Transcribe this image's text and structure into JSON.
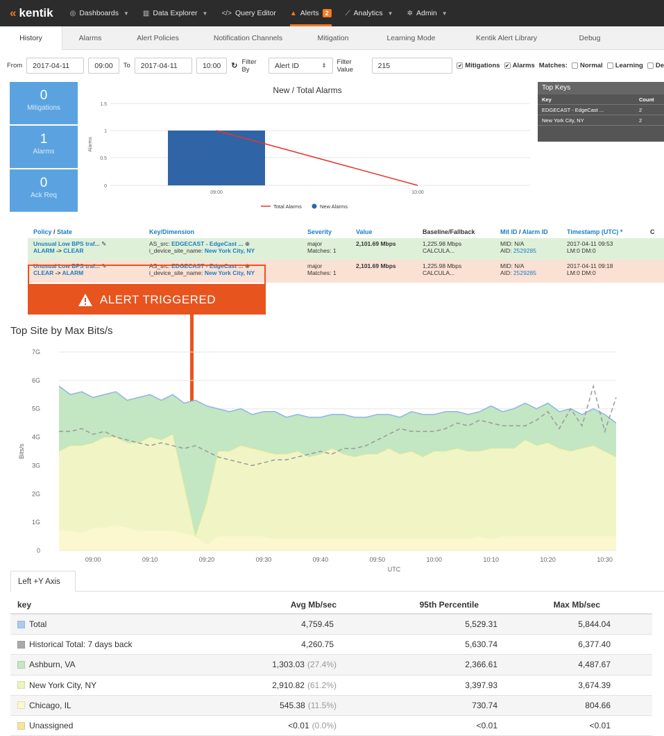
{
  "nav": {
    "logo": "kentik",
    "items": [
      {
        "label": "Dashboards",
        "icon": "gauge-icon",
        "caret": true
      },
      {
        "label": "Data Explorer",
        "icon": "bar-chart-icon",
        "caret": true
      },
      {
        "label": "Query Editor",
        "icon": "code-icon",
        "caret": false
      },
      {
        "label": "Alerts",
        "icon": "bell-icon",
        "caret": false,
        "badge": "2"
      },
      {
        "label": "Analytics",
        "icon": "line-chart-icon",
        "caret": true
      },
      {
        "label": "Admin",
        "icon": "gear-icon",
        "caret": true
      }
    ]
  },
  "subtabs": [
    "History",
    "Alarms",
    "Alert Policies",
    "Notification Channels",
    "Mitigation",
    "Learning Mode",
    "Kentik Alert Library",
    "Debug"
  ],
  "filter": {
    "from_label": "From",
    "from_date": "2017-04-11",
    "from_time": "09:00",
    "to_label": "To",
    "to_date": "2017-04-11",
    "to_time": "10:00",
    "filter_by_label": "Filter By",
    "filter_by_value": "Alert ID",
    "filter_value_label": "Filter Value",
    "filter_value": "215",
    "mitigations": "Mitigations",
    "alarms": "Alarms",
    "matches_label": "Matches:",
    "normal": "Normal",
    "learning": "Learning",
    "d_label": "De"
  },
  "stats": [
    {
      "value": "0",
      "label": "Mitigations"
    },
    {
      "value": "1",
      "label": "Alarms"
    },
    {
      "value": "0",
      "label": "Ack Req"
    }
  ],
  "alarm_chart": {
    "title": "New / Total Alarms",
    "ylabel": "Alarms",
    "yticks": [
      "1.5",
      "1",
      "0.5",
      "0"
    ],
    "xticks": [
      "09:00",
      "10:00"
    ],
    "legend": [
      "Total Alarms",
      "New Alarms"
    ],
    "colors": {
      "total": "#e3342f",
      "new": "#2f64a7"
    }
  },
  "top_keys": {
    "title": "Top Keys",
    "headers": [
      "Key",
      "Count"
    ],
    "rows": [
      {
        "key": "EDGECAST - EdgeCast ...",
        "count": "2"
      },
      {
        "key": "New York City, NY",
        "count": "2"
      }
    ]
  },
  "alarm_table": {
    "headers": {
      "policy": "Policy",
      "state": "State",
      "key": "Key/Dimension",
      "severity": "Severity",
      "value": "Value",
      "baseline": "Baseline/Fallback",
      "mit": "Mit ID",
      "alarm": "Alarm ID",
      "timestamp": "Timestamp (UTC) *",
      "extra": "C"
    },
    "rows": [
      {
        "policy": "Unusual Low BPS traf...",
        "from": "ALARM",
        "to": "CLEAR",
        "key_pre1": "AS_src:",
        "key_val1": "EDGECAST - EdgeCast ...",
        "key_pre2": "i_device_site_name:",
        "key_val2": "New York City, NY",
        "severity": "major",
        "matches": "Matches: 1",
        "value": "2,101.69 Mbps",
        "baseline": "1,225.98 Mbps",
        "fallback": "CALCULA...",
        "mid": "MID: N/A",
        "aid_pre": "AID:",
        "aid": "2529285",
        "ts": "2017-04-11 09:53",
        "lm": "LM:0  DM:0"
      },
      {
        "policy": "Unusual Low BPS traf...",
        "from": "CLEAR",
        "to": "ALARM",
        "key_pre1": "AS_src:",
        "key_val1": "EDGECAST - EdgeCast ...",
        "key_pre2": "i_device_site_name:",
        "key_val2": "New York City, NY",
        "severity": "major",
        "matches": "Matches: 1",
        "value": "2,101.69 Mbps",
        "baseline": "1,225.98 Mbps",
        "fallback": "CALCULA...",
        "mid": "MID: N/A",
        "aid_pre": "AID:",
        "aid": "2529285",
        "ts": "2017-04-11 09:18",
        "lm": "LM:0  DM:0"
      }
    ]
  },
  "annotation": {
    "label": "ALERT TRIGGERED"
  },
  "main_chart": {
    "title": "Top Site by Max Bits/s",
    "ylabel": "Bits/s",
    "xlabel": "UTC",
    "yticks": [
      "0",
      "1G",
      "2G",
      "3G",
      "4G",
      "5G",
      "6G",
      "7G"
    ],
    "xticks": [
      "09:00",
      "09:10",
      "09:20",
      "09:30",
      "09:40",
      "09:50",
      "10:00",
      "10:10",
      "10:20",
      "10:30"
    ],
    "colors": {
      "total": "#aecbee",
      "ashburn": "#c3e6c3",
      "nyc": "#f1f5c5",
      "chicago": "#fbf7cf",
      "historical": "#999999"
    }
  },
  "chart_data": {
    "type": "area",
    "x": [
      "08:54",
      "08:56",
      "08:58",
      "09:00",
      "09:02",
      "09:04",
      "09:06",
      "09:08",
      "09:10",
      "09:12",
      "09:14",
      "09:16",
      "09:18",
      "09:20",
      "09:22",
      "09:24",
      "09:26",
      "09:28",
      "09:30",
      "09:32",
      "09:34",
      "09:36",
      "09:38",
      "09:40",
      "09:42",
      "09:44",
      "09:46",
      "09:48",
      "09:50",
      "09:52",
      "09:54",
      "09:56",
      "09:58",
      "10:00",
      "10:02",
      "10:04",
      "10:06",
      "10:08",
      "10:10",
      "10:12",
      "10:14",
      "10:16",
      "10:18",
      "10:20",
      "10:22",
      "10:24",
      "10:26",
      "10:28",
      "10:30",
      "10:32"
    ],
    "series": [
      {
        "name": "Total",
        "values": [
          5.8,
          5.5,
          5.6,
          5.4,
          5.5,
          5.6,
          5.3,
          5.4,
          5.5,
          5.3,
          5.5,
          5.2,
          5.3,
          5.1,
          5.0,
          4.9,
          5.0,
          4.8,
          4.9,
          4.9,
          4.7,
          4.8,
          4.7,
          4.7,
          4.8,
          4.8,
          4.7,
          4.7,
          4.8,
          4.8,
          4.7,
          4.9,
          4.8,
          4.8,
          4.9,
          4.9,
          4.8,
          4.9,
          5.1,
          4.9,
          5.0,
          5.2,
          5.0,
          5.2,
          4.9,
          5.0,
          4.8,
          5.0,
          4.8,
          4.5
        ]
      },
      {
        "name": "Historical Total: 7 days back",
        "values": [
          4.2,
          4.2,
          4.3,
          4.1,
          4.2,
          4.0,
          3.9,
          3.8,
          3.7,
          3.8,
          3.7,
          3.6,
          3.7,
          3.5,
          3.3,
          3.2,
          3.1,
          3.0,
          3.1,
          3.2,
          3.2,
          3.3,
          3.4,
          3.5,
          3.4,
          3.6,
          3.6,
          3.7,
          3.9,
          4.1,
          4.3,
          4.2,
          4.2,
          4.2,
          4.3,
          4.5,
          4.4,
          4.6,
          4.5,
          4.4,
          4.4,
          4.4,
          4.6,
          4.9,
          4.3,
          5.0,
          4.4,
          5.8,
          4.2,
          5.4
        ]
      },
      {
        "name": "Ashburn, VA",
        "values": [
          2.3,
          1.8,
          1.9,
          1.6,
          1.5,
          1.6,
          1.5,
          1.6,
          1.5,
          1.4,
          1.4,
          2.9,
          3.8,
          3.4,
          1.5,
          1.4,
          1.3,
          1.2,
          1.4,
          1.5,
          1.3,
          1.3,
          1.4,
          1.3,
          1.2,
          1.4,
          1.4,
          1.3,
          1.4,
          1.2,
          1.3,
          1.4,
          1.5,
          1.3,
          1.4,
          1.3,
          1.3,
          1.4,
          1.5,
          1.3,
          1.4,
          1.3,
          1.3,
          1.4,
          1.3,
          1.5,
          1.2,
          1.3,
          1.3,
          1.2
        ]
      },
      {
        "name": "New York City, NY",
        "values": [
          2.8,
          3.0,
          3.1,
          3.0,
          3.2,
          3.1,
          3.0,
          3.1,
          3.3,
          3.2,
          3.4,
          1.7,
          0.0,
          1.5,
          3.0,
          3.0,
          3.2,
          3.1,
          3.0,
          3.0,
          3.0,
          3.1,
          2.9,
          3.0,
          3.2,
          3.0,
          2.9,
          3.0,
          3.0,
          3.2,
          3.0,
          3.1,
          2.9,
          3.1,
          3.1,
          3.2,
          3.1,
          3.0,
          3.2,
          3.1,
          3.1,
          3.4,
          3.2,
          3.3,
          3.1,
          3.0,
          3.1,
          3.2,
          3.0,
          2.8
        ]
      },
      {
        "name": "Chicago, IL",
        "values": [
          0.7,
          0.7,
          0.6,
          0.8,
          0.8,
          0.9,
          0.8,
          0.7,
          0.7,
          0.7,
          0.7,
          0.6,
          0.5,
          0.2,
          0.5,
          0.5,
          0.5,
          0.5,
          0.5,
          0.4,
          0.4,
          0.4,
          0.4,
          0.4,
          0.4,
          0.4,
          0.4,
          0.4,
          0.4,
          0.4,
          0.4,
          0.4,
          0.4,
          0.4,
          0.4,
          0.4,
          0.4,
          0.5,
          0.4,
          0.5,
          0.5,
          0.5,
          0.5,
          0.5,
          0.5,
          0.5,
          0.5,
          0.5,
          0.5,
          0.5
        ]
      }
    ],
    "ylim": [
      0,
      7
    ]
  },
  "legend_tab": "Left +Y Axis",
  "summary_table": {
    "headers": [
      "key",
      "Avg Mb/sec",
      "95th Percentile",
      "Max Mb/sec"
    ],
    "rows": [
      {
        "key": "Total",
        "color": "#aecbee",
        "avg": "4,759.45",
        "pct": "",
        "p95": "5,529.31",
        "max": "5,844.04"
      },
      {
        "key": "Historical Total: 7 days back",
        "color": "#aaaaaa",
        "avg": "4,260.75",
        "pct": "",
        "p95": "5,630.74",
        "max": "6,377.40"
      },
      {
        "key": "Ashburn, VA",
        "color": "#c3e6c3",
        "avg": "1,303.03",
        "pct": "(27.4%)",
        "p95": "2,366.61",
        "max": "4,487.67"
      },
      {
        "key": "New York City, NY",
        "color": "#eef3c0",
        "avg": "2,910.82",
        "pct": "(61.2%)",
        "p95": "3,397.93",
        "max": "3,674.39"
      },
      {
        "key": "Chicago, IL",
        "color": "#fbf7cf",
        "avg": "545.38",
        "pct": "(11.5%)",
        "p95": "730.74",
        "max": "804.66"
      },
      {
        "key": "Unassigned",
        "color": "#f6e3a0",
        "avg": "<0.01",
        "pct": "(0.0%)",
        "p95": "<0.01",
        "max": "<0.01"
      }
    ]
  }
}
